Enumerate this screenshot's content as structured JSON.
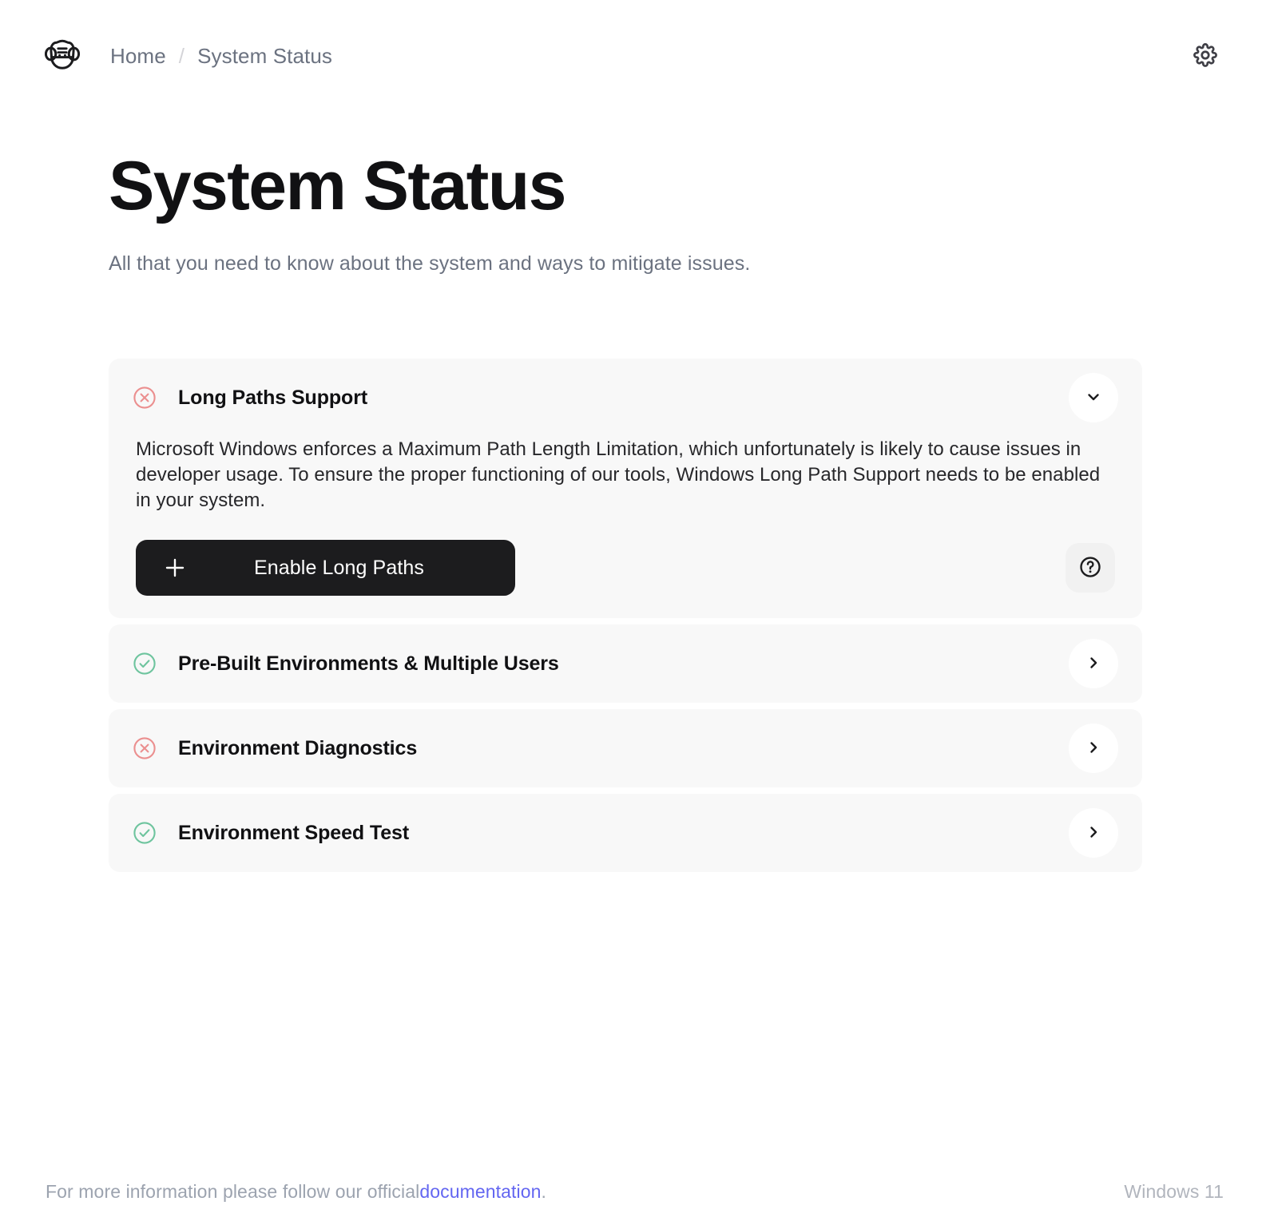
{
  "header": {
    "logo_icon": "monkey-face-logo",
    "breadcrumb": {
      "home_label": "Home",
      "separator": "/",
      "current_label": "System Status"
    },
    "settings_icon": "gear-icon"
  },
  "page": {
    "title": "System Status",
    "subtitle": "All that you need to know about the system and ways to mitigate issues."
  },
  "cards": [
    {
      "title": "Long Paths Support",
      "status": "error",
      "status_icon": "circle-x-icon",
      "expanded": true,
      "toggle_icon": "chevron-down-icon",
      "body": "Microsoft Windows enforces a Maximum Path Length Limitation, which unfortunately is likely to cause issues in developer usage. To ensure the proper functioning of our tools, Windows Long Path Support needs to be enabled in your system.",
      "action_label": "Enable Long Paths",
      "action_icon": "plus-icon",
      "help_icon": "question-circle-icon"
    },
    {
      "title": "Pre-Built Environments & Multiple Users",
      "status": "ok",
      "status_icon": "circle-check-icon",
      "expanded": false,
      "toggle_icon": "chevron-right-icon"
    },
    {
      "title": "Environment Diagnostics",
      "status": "error",
      "status_icon": "circle-x-icon",
      "expanded": false,
      "toggle_icon": "chevron-right-icon"
    },
    {
      "title": "Environment Speed Test",
      "status": "ok",
      "status_icon": "circle-check-icon",
      "expanded": false,
      "toggle_icon": "chevron-right-icon"
    }
  ],
  "footer": {
    "text_before": "For more information please follow our official ",
    "link_label": "documentation",
    "text_after": ".",
    "os_label": "Windows 11"
  },
  "colors": {
    "error": "#eb8f8f",
    "ok": "#6ec49e",
    "accent_link": "#6366f1",
    "button_bg": "#1c1c1e",
    "card_bg": "#f8f8f8"
  }
}
